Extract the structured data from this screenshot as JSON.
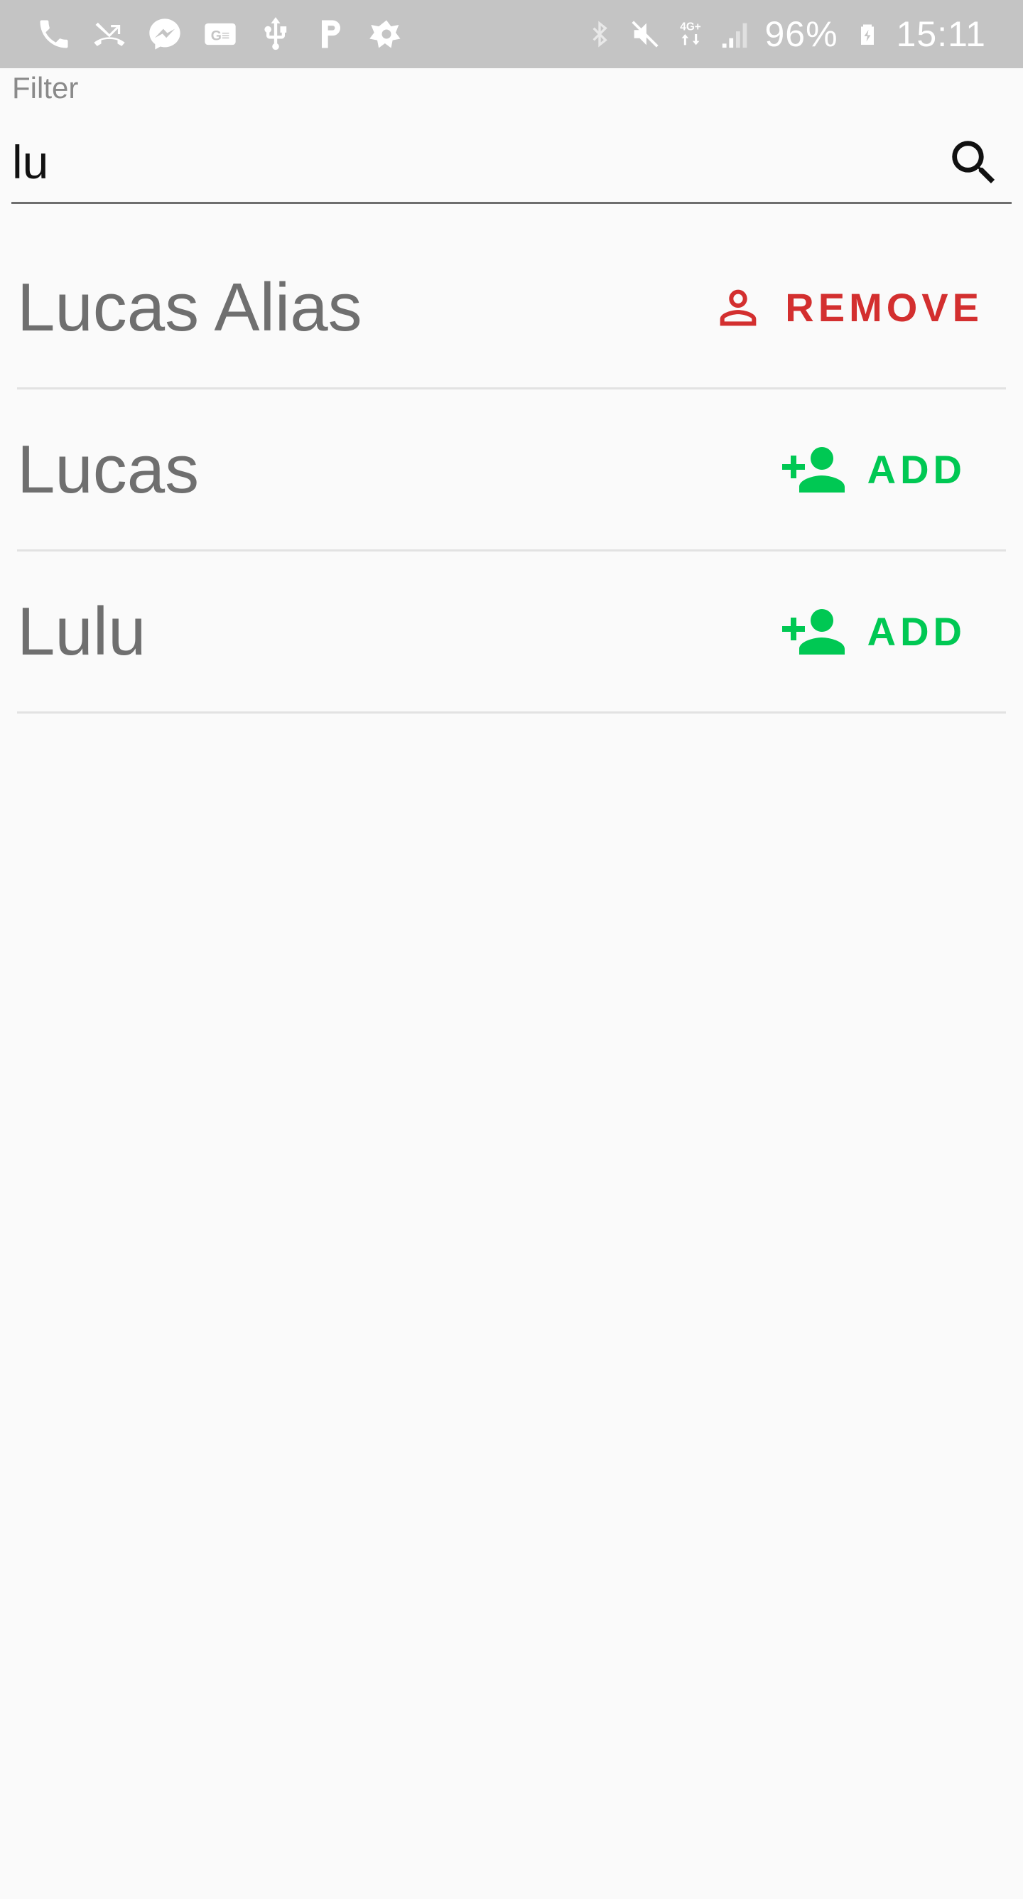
{
  "status_bar": {
    "left_icons": [
      "phone-icon",
      "missed-call-icon",
      "messenger-icon",
      "ge-icon",
      "usb-icon",
      "p-app-icon",
      "avast-icon"
    ],
    "right_icons": [
      "bluetooth-icon",
      "mute-icon",
      "4g-icon",
      "signal-icon"
    ],
    "battery": "96%",
    "time": "15:11"
  },
  "filter": {
    "label": "Filter",
    "value": "lu"
  },
  "results": [
    {
      "name": "Lucas Alias",
      "action_label": "REMOVE",
      "action_type": "remove",
      "color": "#d32f2f"
    },
    {
      "name": "Lucas",
      "action_label": "ADD",
      "action_type": "add",
      "color": "#00c853"
    },
    {
      "name": "Lulu",
      "action_label": "ADD",
      "action_type": "add",
      "color": "#00c853"
    }
  ]
}
